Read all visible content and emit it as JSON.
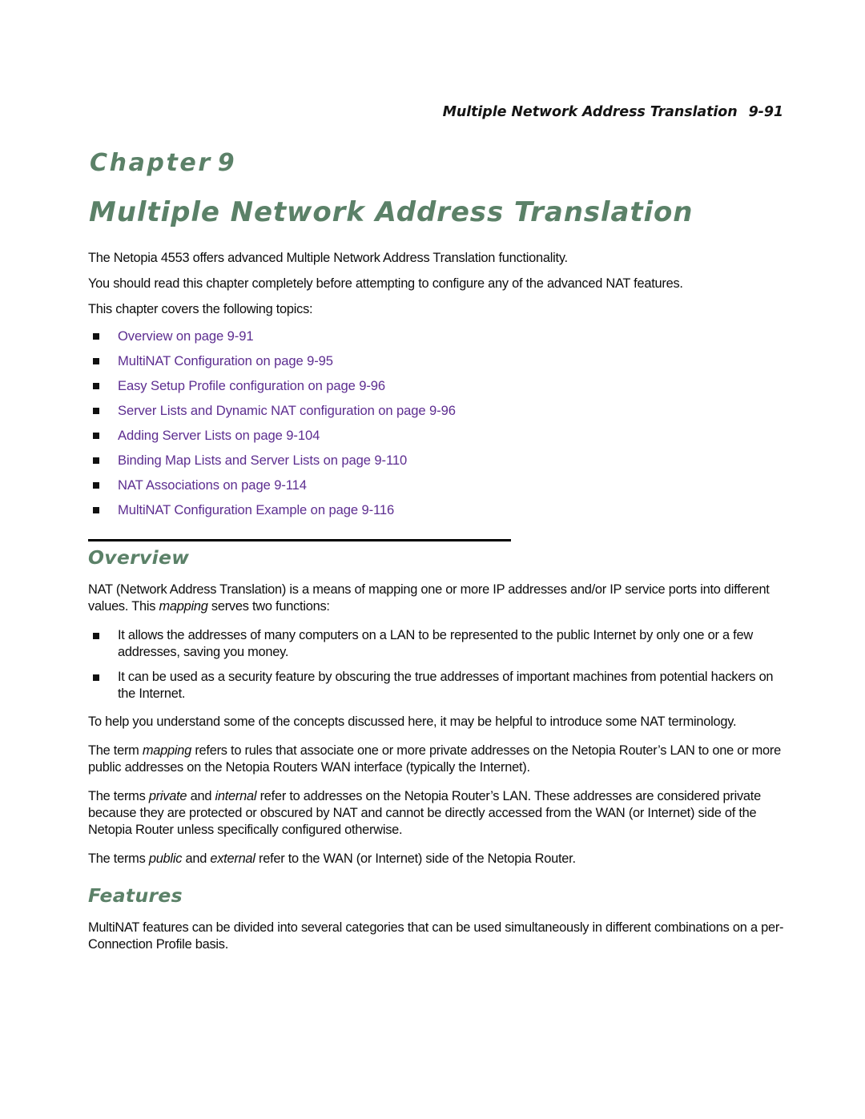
{
  "header": {
    "title": "Multiple Network Address Translation",
    "page_number": "9-91"
  },
  "chapter": {
    "label": "Chapter",
    "number": "9",
    "title": "Multiple Network Address Translation"
  },
  "colors": {
    "heading_green": "#5b8168",
    "link_purple": "#5d2d90",
    "body_black": "#0d0d0d",
    "rule_black": "#000000"
  },
  "intro": {
    "paragraph_1": "The Netopia 4553 offers advanced Multiple Network Address Translation functionality.",
    "paragraph_2": "You should read this chapter completely before attempting to configure any of the advanced NAT features.",
    "paragraph_3": "This chapter covers the following topics:"
  },
  "toc": {
    "items": [
      {
        "label": "Overview on page 9-91"
      },
      {
        "label": "MultiNAT Configuration on page 9-95"
      },
      {
        "label": "Easy Setup Profile configuration on page 9-96"
      },
      {
        "label": "Server Lists and Dynamic NAT configuration on page 9-96"
      },
      {
        "label": "Adding Server Lists on page 9-104"
      },
      {
        "label": "Binding Map Lists and Server Lists on page 9-110"
      },
      {
        "label": "NAT Associations on page 9-114"
      },
      {
        "label": "MultiNAT Configuration Example on page 9-116"
      }
    ]
  },
  "overview": {
    "heading": "Overview",
    "intro_a": "NAT (Network Address Translation) is a means of mapping one or more IP addresses and/or IP service ports into different values. This ",
    "intro_italic": "mapping",
    "intro_b": " serves two functions:",
    "bullets": [
      "It allows the addresses of many computers on a LAN to be represented to the public Internet by only one or a few addresses, saving you money.",
      "It can be used as a security feature by obscuring the true addresses of important machines from potential hackers on the Internet."
    ],
    "para_terminology": "To help you understand some of the concepts discussed here, it may be helpful to introduce some NAT terminology.",
    "para_mapping_a": "The term ",
    "para_mapping_italic": "mapping",
    "para_mapping_b": " refers to rules that associate one or more private addresses on the Netopia Router’s LAN to one or more public addresses on the Netopia Routers WAN interface (typically the Internet).",
    "para_private_a": "The terms ",
    "para_private_italic_1": "private",
    "para_private_mid": " and ",
    "para_private_italic_2": "internal",
    "para_private_b": " refer to addresses on the Netopia Router’s LAN. These addresses are considered private because they are protected or obscured by NAT and cannot be directly accessed from the WAN (or Internet) side of the Netopia Router unless specifically configured otherwise.",
    "para_public_a": "The terms ",
    "para_public_italic_1": "public",
    "para_public_mid": " and ",
    "para_public_italic_2": "external",
    "para_public_b": " refer to the WAN (or Internet) side of the Netopia Router."
  },
  "features": {
    "heading": "Features",
    "paragraph": "MultiNAT features can be divided into several categories that can be used simultaneously in different combinations on a per-Connection Profile basis."
  }
}
